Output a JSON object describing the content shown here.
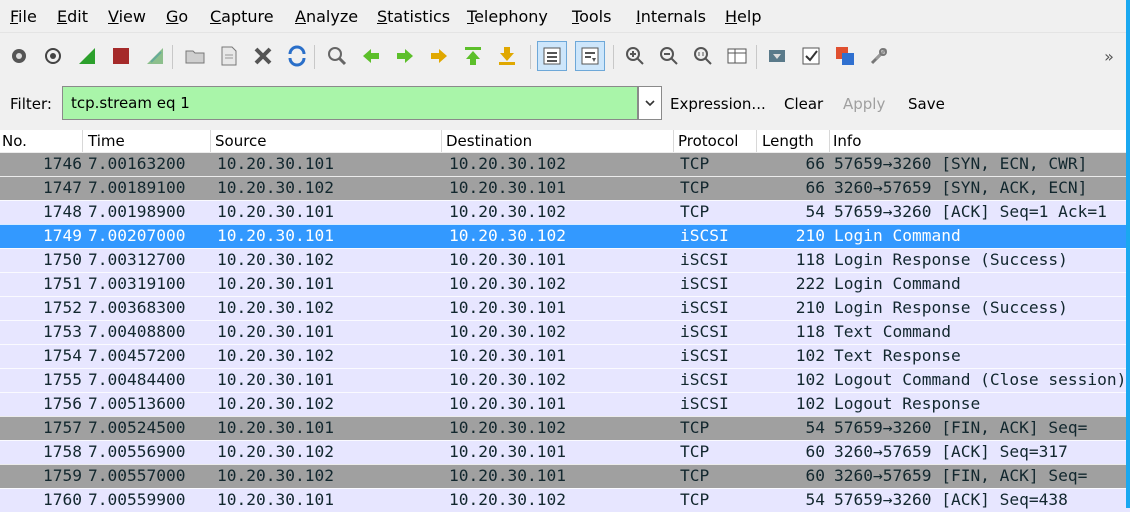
{
  "menu": [
    "File",
    "Edit",
    "View",
    "Go",
    "Capture",
    "Analyze",
    "Statistics",
    "Telephony",
    "Tools",
    "Internals",
    "Help"
  ],
  "toolbar": {
    "icons": [
      "interface-list-icon",
      "capture-options-icon",
      "start-capture-icon",
      "stop-capture-icon",
      "restart-capture-icon",
      "open-file-icon",
      "save-file-icon",
      "close-file-icon",
      "reload-icon",
      "find-packet-icon",
      "go-back-icon",
      "go-forward-icon",
      "go-to-packet-icon",
      "go-first-packet-icon",
      "go-last-packet-icon",
      "colorize-icon",
      "auto-scroll-icon",
      "zoom-in-icon",
      "zoom-out-icon",
      "normal-size-icon",
      "resize-columns-icon",
      "capture-filters-icon",
      "display-filters-icon",
      "coloring-rules-icon",
      "preferences-icon",
      "more-icon"
    ],
    "more": "»"
  },
  "filter": {
    "label": "Filter:",
    "value": "tcp.stream eq 1",
    "expression": "Expression...",
    "clear": "Clear",
    "apply": "Apply",
    "save": "Save"
  },
  "columns": [
    "No.",
    "Time",
    "Source",
    "Destination",
    "Protocol",
    "Length",
    "Info"
  ],
  "colors": {
    "tcp_control": "#a0a0a0",
    "tcp_data": "#e7e6ff",
    "iscsi": "#e7e6ff",
    "selected": "#3399ff",
    "filter_valid": "#a9f5a9"
  },
  "packets": [
    {
      "no": "1746",
      "time": "7.00163200",
      "src": "10.20.30.101",
      "dst": "10.20.30.102",
      "proto": "TCP",
      "len": "66",
      "info": "57659→3260 [SYN, ECN, CWR]",
      "style": "tcp_control"
    },
    {
      "no": "1747",
      "time": "7.00189100",
      "src": "10.20.30.102",
      "dst": "10.20.30.101",
      "proto": "TCP",
      "len": "66",
      "info": "3260→57659 [SYN, ACK, ECN]",
      "style": "tcp_control"
    },
    {
      "no": "1748",
      "time": "7.00198900",
      "src": "10.20.30.101",
      "dst": "10.20.30.102",
      "proto": "TCP",
      "len": "54",
      "info": "57659→3260 [ACK] Seq=1 Ack=1",
      "style": "tcp_data"
    },
    {
      "no": "1749",
      "time": "7.00207000",
      "src": "10.20.30.101",
      "dst": "10.20.30.102",
      "proto": "iSCSI",
      "len": "210",
      "info": "Login Command",
      "style": "selected"
    },
    {
      "no": "1750",
      "time": "7.00312700",
      "src": "10.20.30.102",
      "dst": "10.20.30.101",
      "proto": "iSCSI",
      "len": "118",
      "info": "Login Response (Success)",
      "style": "iscsi"
    },
    {
      "no": "1751",
      "time": "7.00319100",
      "src": "10.20.30.101",
      "dst": "10.20.30.102",
      "proto": "iSCSI",
      "len": "222",
      "info": "Login Command",
      "style": "iscsi"
    },
    {
      "no": "1752",
      "time": "7.00368300",
      "src": "10.20.30.102",
      "dst": "10.20.30.101",
      "proto": "iSCSI",
      "len": "210",
      "info": "Login Response (Success)",
      "style": "iscsi"
    },
    {
      "no": "1753",
      "time": "7.00408800",
      "src": "10.20.30.101",
      "dst": "10.20.30.102",
      "proto": "iSCSI",
      "len": "118",
      "info": "Text Command",
      "style": "iscsi"
    },
    {
      "no": "1754",
      "time": "7.00457200",
      "src": "10.20.30.102",
      "dst": "10.20.30.101",
      "proto": "iSCSI",
      "len": "102",
      "info": "Text Response",
      "style": "iscsi"
    },
    {
      "no": "1755",
      "time": "7.00484400",
      "src": "10.20.30.101",
      "dst": "10.20.30.102",
      "proto": "iSCSI",
      "len": "102",
      "info": "Logout Command (Close session)",
      "style": "iscsi"
    },
    {
      "no": "1756",
      "time": "7.00513600",
      "src": "10.20.30.102",
      "dst": "10.20.30.101",
      "proto": "iSCSI",
      "len": "102",
      "info": "Logout Response",
      "style": "iscsi"
    },
    {
      "no": "1757",
      "time": "7.00524500",
      "src": "10.20.30.101",
      "dst": "10.20.30.102",
      "proto": "TCP",
      "len": "54",
      "info": "57659→3260 [FIN, ACK] Seq=",
      "style": "tcp_control"
    },
    {
      "no": "1758",
      "time": "7.00556900",
      "src": "10.20.30.102",
      "dst": "10.20.30.101",
      "proto": "TCP",
      "len": "60",
      "info": "3260→57659 [ACK] Seq=317",
      "style": "tcp_data"
    },
    {
      "no": "1759",
      "time": "7.00557000",
      "src": "10.20.30.102",
      "dst": "10.20.30.101",
      "proto": "TCP",
      "len": "60",
      "info": "3260→57659 [FIN, ACK] Seq=",
      "style": "tcp_control"
    },
    {
      "no": "1760",
      "time": "7.00559900",
      "src": "10.20.30.101",
      "dst": "10.20.30.102",
      "proto": "TCP",
      "len": "54",
      "info": "57659→3260 [ACK] Seq=438",
      "style": "tcp_data"
    }
  ]
}
